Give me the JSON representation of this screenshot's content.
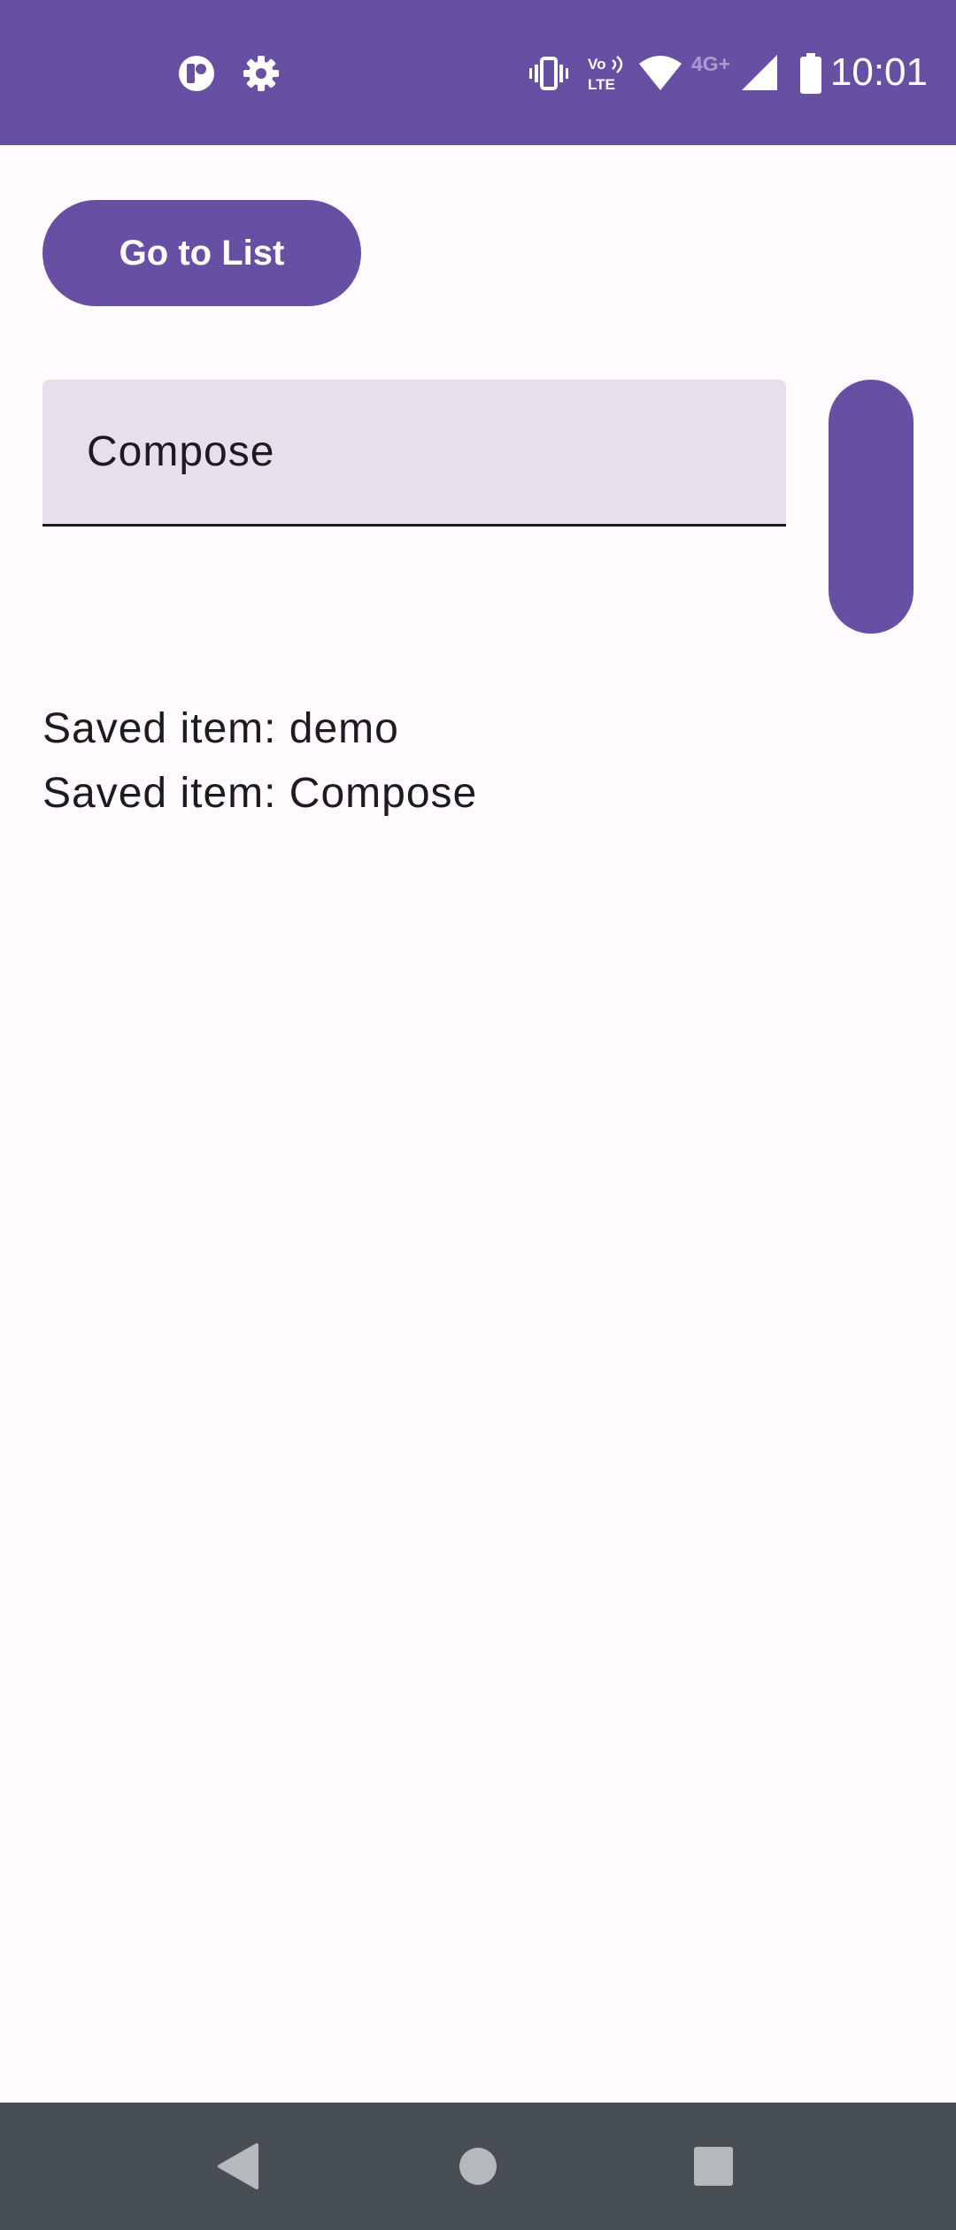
{
  "status_bar": {
    "time": "10:01",
    "left_icons": [
      "app-notification-icon",
      "settings-gear-icon"
    ],
    "right_icons": [
      "vibrate-icon",
      "volte-icon",
      "wifi-icon",
      "network-4g-plus-icon",
      "cell-signal-icon",
      "battery-icon"
    ],
    "volte_label_top": "Vo",
    "volte_label_bottom": "LTE",
    "network_label": "4G+"
  },
  "main": {
    "go_button_label": "Go to List",
    "text_field_value": "Compose",
    "saved_items": [
      "Saved item: demo",
      "Saved item: Compose"
    ]
  },
  "nav_bar": {
    "buttons": [
      "back",
      "home",
      "recents"
    ]
  },
  "colors": {
    "primary": "#6750A4",
    "background": "#FFFBFE",
    "text_field_bg": "#E7E0EC",
    "on_surface": "#1C1B1F",
    "nav_bar": "#474E54"
  }
}
